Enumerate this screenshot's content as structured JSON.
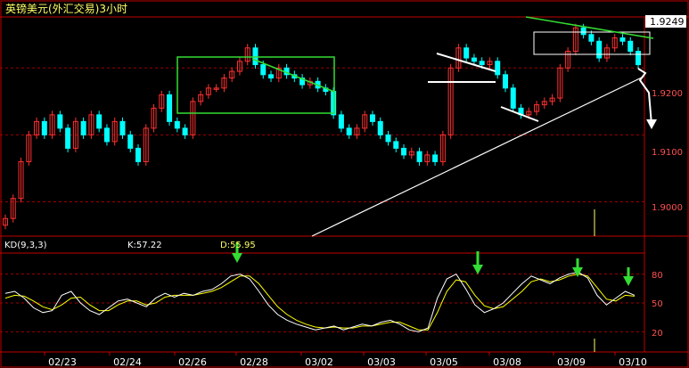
{
  "title": "英镑美元(外汇交易)3小时",
  "price_panel": {
    "last_price_label": "1.9249",
    "y_ticks": [
      "1.9200",
      "1.9100",
      "1.9000"
    ]
  },
  "indicator_panel": {
    "title": "KD(9,3,3)",
    "k_label": "K:57.22",
    "d_label": "D:55.95",
    "y_ticks": [
      "80",
      "50",
      "20"
    ]
  },
  "x_ticks": [
    "02/23",
    "02/24",
    "02/26",
    "02/28",
    "03/02",
    "03/03",
    "03/05",
    "03/08",
    "03/09",
    "03/10"
  ],
  "colors": {
    "background": "#000000",
    "frame": "#c00000",
    "up_candle": "#ff3030",
    "down_candle": "#00ffff",
    "k_line": "#ffffff",
    "d_line": "#ffff00",
    "annotation_green": "#33dd33",
    "annotation_white": "#ffffff",
    "label_text": "#ffff66"
  },
  "chart_data": {
    "type": "candlestick",
    "title": "英镑美元(外汇交易)3小时",
    "series": [
      {
        "name": "K",
        "last": 57.22
      },
      {
        "name": "D",
        "last": 55.95
      }
    ],
    "price_range": [
      1.895,
      1.9275
    ],
    "kd_range": [
      0,
      100
    ],
    "closes": [
      1.8975,
      1.9005,
      1.906,
      1.91,
      1.912,
      1.91,
      1.913,
      1.911,
      1.908,
      1.912,
      1.91,
      1.913,
      1.911,
      1.909,
      1.912,
      1.91,
      1.908,
      1.906,
      1.911,
      1.914,
      1.916,
      1.912,
      1.911,
      1.91,
      1.915,
      1.916,
      1.917,
      1.917,
      1.9185,
      1.9195,
      1.921,
      1.923,
      1.9205,
      1.919,
      1.9185,
      1.92,
      1.919,
      1.9185,
      1.9175,
      1.918,
      1.917,
      1.9165,
      1.913,
      1.911,
      1.91,
      1.911,
      1.913,
      1.912,
      1.91,
      1.909,
      1.908,
      1.907,
      1.9075,
      1.906,
      1.907,
      1.906,
      1.91,
      1.92,
      1.923,
      1.9215,
      1.921,
      1.9205,
      1.921,
      1.919,
      1.917,
      1.914,
      1.913,
      1.9135,
      1.9145,
      1.915,
      1.9155,
      1.92,
      1.9225,
      1.926,
      1.925,
      1.924,
      1.9215,
      1.923,
      1.9245,
      1.924,
      1.9225,
      1.9205
    ],
    "k": [
      60,
      62,
      55,
      45,
      40,
      42,
      58,
      62,
      50,
      42,
      38,
      45,
      52,
      54,
      50,
      46,
      55,
      60,
      56,
      60,
      58,
      62,
      64,
      70,
      78,
      80,
      75,
      62,
      48,
      38,
      32,
      28,
      25,
      22,
      24,
      26,
      22,
      25,
      28,
      26,
      30,
      32,
      28,
      22,
      20,
      24,
      55,
      75,
      80,
      65,
      48,
      40,
      44,
      50,
      60,
      70,
      78,
      74,
      70,
      76,
      80,
      82,
      76,
      58,
      48,
      55,
      62,
      58
    ],
    "d": [
      55,
      58,
      57,
      52,
      46,
      43,
      48,
      55,
      56,
      48,
      42,
      42,
      48,
      52,
      52,
      48,
      50,
      56,
      58,
      58,
      58,
      60,
      62,
      66,
      72,
      78,
      78,
      70,
      58,
      46,
      38,
      32,
      28,
      25,
      24,
      25,
      24,
      24,
      26,
      26,
      28,
      30,
      30,
      26,
      22,
      22,
      40,
      62,
      74,
      72,
      58,
      47,
      44,
      46,
      54,
      62,
      72,
      75,
      72,
      74,
      78,
      80,
      78,
      66,
      54,
      52,
      58,
      57
    ]
  }
}
